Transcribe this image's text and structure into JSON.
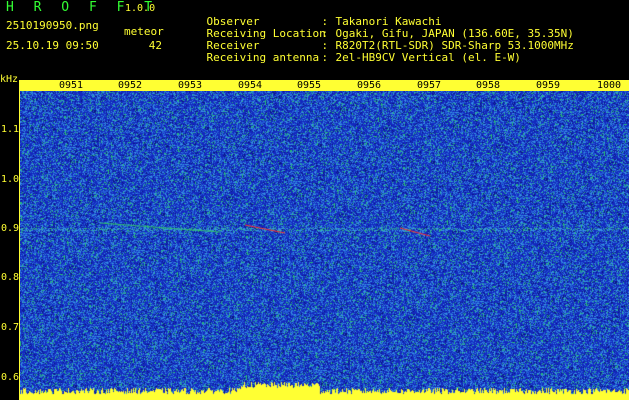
{
  "header": {
    "app_name": "H R O F F T",
    "app_version": "1.0.0",
    "file_name": "2510190950.png",
    "event_label": "meteor",
    "timestamp": "25.10.19 09:50",
    "event_count": "42"
  },
  "metadata": [
    {
      "key": "Observer",
      "value": "Takanori Kawachi"
    },
    {
      "key": "Receiving Location",
      "value": "Ogaki, Gifu, JAPAN (136.60E, 35.35N)"
    },
    {
      "key": "Receiver",
      "value": "R820T2(RTL-SDR) SDR-Sharp 53.1000MHz"
    },
    {
      "key": "Receiving antenna",
      "value": "2el-HB9CV Vertical (el. E-W)"
    }
  ],
  "separator": ":",
  "spectrogram": {
    "y_unit": "kHz",
    "y_ticks": [
      "1.1",
      "1.0",
      "0.9",
      "0.8",
      "0.7",
      "0.6"
    ],
    "x_ticks": [
      "0951",
      "0952",
      "0953",
      "0954",
      "0955",
      "0956",
      "0957",
      "0958",
      "0959",
      "1000"
    ],
    "colors": {
      "background": "#1a2fbf",
      "noise_light": "#3aa0e0",
      "noise_green": "#30c070",
      "signal_red": "#ff3030",
      "level_yellow": "#ffff33",
      "label_yellow": "#ffff33",
      "title_green": "#33ff33"
    }
  }
}
